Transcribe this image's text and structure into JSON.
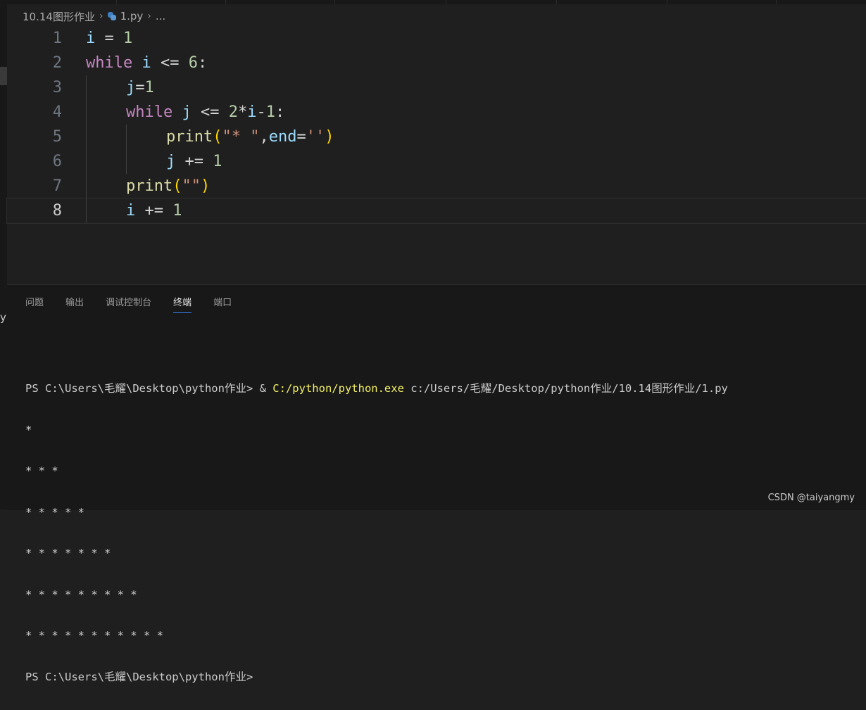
{
  "breadcrumb": {
    "folder": "10.14图形作业",
    "file": "1.py",
    "more": "..."
  },
  "editor": {
    "active_line": 8,
    "lines": [
      {
        "n": "1",
        "tokens": [
          [
            "var",
            "i"
          ],
          [
            "op",
            " = "
          ],
          [
            "num",
            "1"
          ]
        ]
      },
      {
        "n": "2",
        "tokens": [
          [
            "kw",
            "while"
          ],
          [
            "op",
            " "
          ],
          [
            "var",
            "i"
          ],
          [
            "op",
            " <= "
          ],
          [
            "num",
            "6"
          ],
          [
            "op",
            ":"
          ]
        ]
      },
      {
        "n": "3",
        "tokens": [
          [
            "var",
            "j"
          ],
          [
            "op",
            "="
          ],
          [
            "num",
            "1"
          ]
        ]
      },
      {
        "n": "4",
        "tokens": [
          [
            "kw",
            "while"
          ],
          [
            "op",
            " "
          ],
          [
            "var",
            "j"
          ],
          [
            "op",
            " <= "
          ],
          [
            "num",
            "2"
          ],
          [
            "op",
            "*"
          ],
          [
            "var",
            "i"
          ],
          [
            "op",
            "-"
          ],
          [
            "num",
            "1"
          ],
          [
            "op",
            ":"
          ]
        ]
      },
      {
        "n": "5",
        "tokens": [
          [
            "fn",
            "print"
          ],
          [
            "paren",
            "("
          ],
          [
            "str",
            "\"* \""
          ],
          [
            "op",
            ","
          ],
          [
            "var",
            "end"
          ],
          [
            "op",
            "="
          ],
          [
            "str",
            "''"
          ],
          [
            "paren",
            ")"
          ]
        ]
      },
      {
        "n": "6",
        "tokens": [
          [
            "var",
            "j"
          ],
          [
            "op",
            " += "
          ],
          [
            "num",
            "1"
          ]
        ]
      },
      {
        "n": "7",
        "tokens": [
          [
            "fn",
            "print"
          ],
          [
            "paren",
            "("
          ],
          [
            "str",
            "\"\""
          ],
          [
            "paren",
            ")"
          ]
        ]
      },
      {
        "n": "8",
        "tokens": [
          [
            "var",
            "i"
          ],
          [
            "op",
            " += "
          ],
          [
            "num",
            "1"
          ]
        ]
      }
    ]
  },
  "panel": {
    "tabs": [
      "问题",
      "输出",
      "调试控制台",
      "终端",
      "端口"
    ],
    "active_tab": "终端"
  },
  "terminal": {
    "command_prefix": "PS C:\\Users\\毛耀\\Desktop\\python作业> & ",
    "command_exe": "C:/python/python.exe",
    "command_arg": " c:/Users/毛耀/Desktop/python作业/10.14图形作业/1.py",
    "output_lines": [
      "*",
      "* * *",
      "* * * * *",
      "* * * * * * *",
      "* * * * * * * * *",
      "* * * * * * * * * * *"
    ],
    "prompt": "PS C:\\Users\\毛耀\\Desktop\\python作业>"
  },
  "watermark": "CSDN @taiyangmy",
  "side_fragment": "y",
  "colors": {
    "keyword": "#c586c0",
    "variable": "#9cdcfe",
    "number": "#b5cea8",
    "function": "#dcdcaa",
    "string": "#ce9178",
    "bracket": "#ffd700",
    "terminal_exe": "#f2f064",
    "active_tab_underline": "#3b82f6"
  }
}
